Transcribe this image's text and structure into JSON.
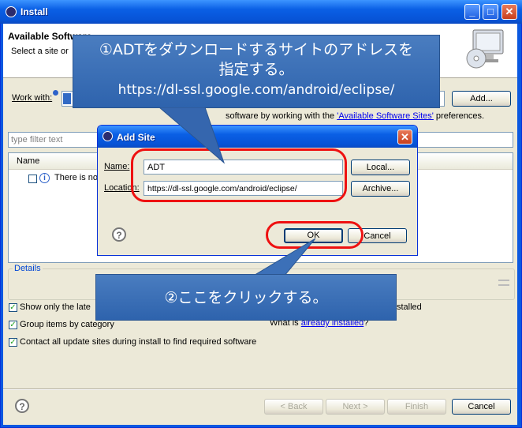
{
  "window": {
    "title": "Install"
  },
  "banner": {
    "title": "Available Software",
    "subtitle": "Select a site or"
  },
  "work_with": {
    "label": "Work with:",
    "add_label": "Add...",
    "hint_tail": "software by working with the",
    "link": "'Available Software Sites'",
    "hint_end": "preferences."
  },
  "filter": {
    "placeholder": "type filter text"
  },
  "table": {
    "column_name": "Name",
    "row_text": "There is no"
  },
  "details": {
    "label": "Details"
  },
  "options": {
    "show_latest": "Show only the late",
    "group_by_category": "Group items by category",
    "contact_sites": "Contact all update sites during install to find required software",
    "hide_installed_tail": "stalled",
    "what_is": "What is",
    "already_installed_link": "already installed",
    "what_is_end": "?"
  },
  "footer": {
    "back": "< Back",
    "next": "Next >",
    "finish": "Finish",
    "cancel": "Cancel"
  },
  "dialog": {
    "title": "Add Site",
    "name_label": "Name:",
    "name_value": "ADT",
    "location_label": "Location:",
    "location_value": "https://dl-ssl.google.com/android/eclipse/",
    "local_button": "Local...",
    "archive_button": "Archive...",
    "ok_button": "OK",
    "cancel_button": "Cancel"
  },
  "callout1": {
    "line1": "①ADTをダウンロードするサイトのアドレスを",
    "line2": "指定する。",
    "line3": "https://dl-ssl.google.com/android/eclipse/"
  },
  "callout2": {
    "text": "②ここをクリックする。"
  },
  "colors": {
    "title_blue": "#0a5fe5",
    "callout_blue": "#3b6fb6",
    "highlight_red": "#ee1111",
    "panel": "#ece9d8"
  }
}
